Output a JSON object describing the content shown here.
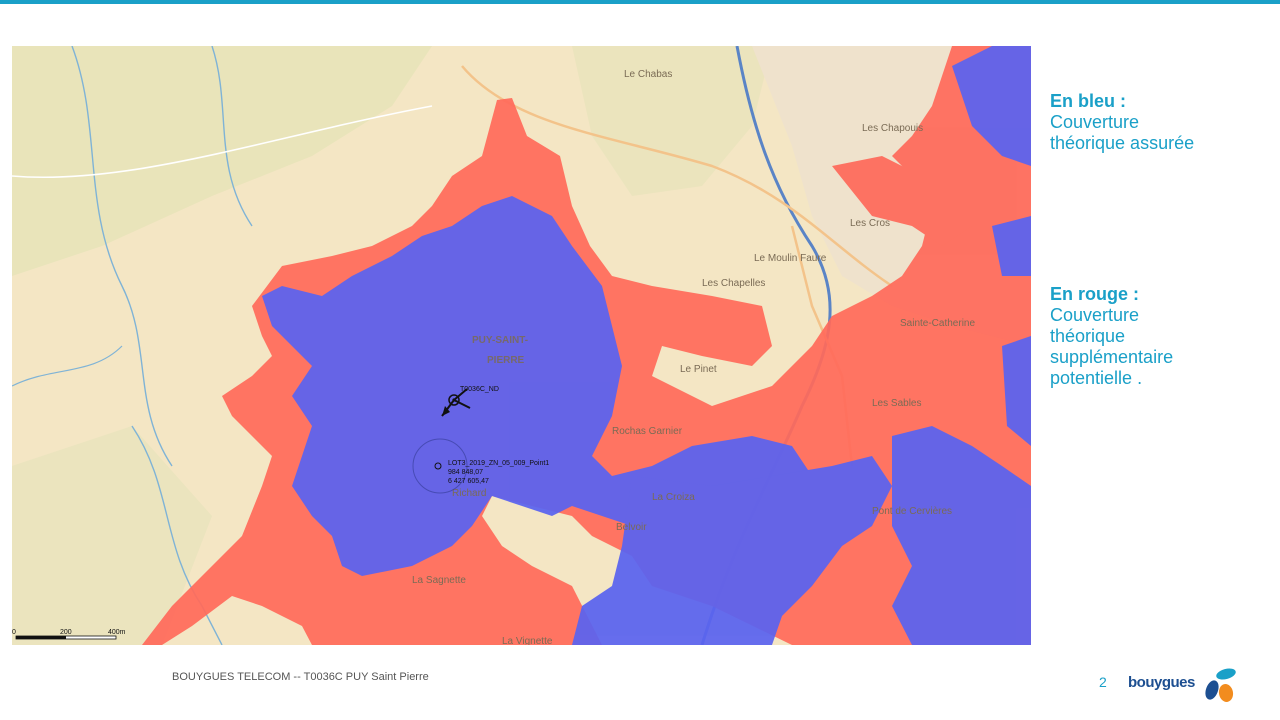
{
  "legend": {
    "blue_title": "En bleu :",
    "blue_lines": [
      "Couverture",
      "théorique assurée"
    ],
    "red_title": "En rouge :",
    "red_lines": [
      "Couverture",
      "théorique",
      "supplémentaire",
      "potentielle ."
    ]
  },
  "footer": {
    "text": "BOUYGUES TELECOM   -- T0036C PUY Saint Pierre",
    "page": "2",
    "logo": "bouygues"
  },
  "map": {
    "places": [
      "Le Chabas",
      "Les Chapouis",
      "Les Cros",
      "Le Moulin Faure",
      "Les Chapelles",
      "Sainte-Catherine",
      "Le Pinet",
      "Rochas Garnier",
      "La Croiza",
      "Belvoir",
      "La Sagnette",
      "La Vignette",
      "Pont de Cervières",
      "Richard",
      "Les Sables"
    ],
    "town_label": [
      "PUY-SAINT-",
      "PIERRE"
    ],
    "site_label": "T0036C_ND",
    "point_lines": [
      "LOT3_2019_ZN_05_009_Point1",
      "984 848,07",
      "6 427 605,47"
    ],
    "scale_labels": [
      "0",
      "200",
      "400m"
    ],
    "colors": {
      "blue_coverage": "#5a63f0",
      "red_coverage": "#ff6a5a",
      "base": "#f4e6c4",
      "accent": "#1aa0c8"
    }
  }
}
